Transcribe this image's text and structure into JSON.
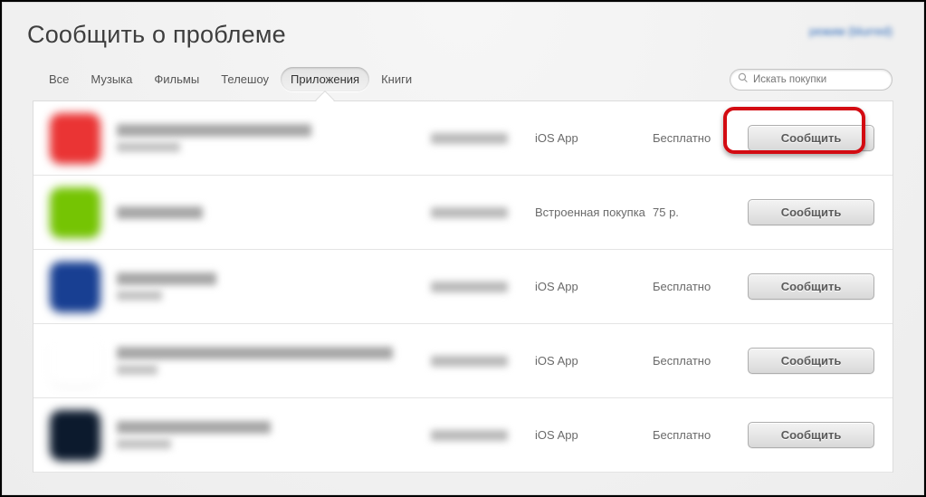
{
  "title": "Сообщить о проблеме",
  "user_id": "режим (blurred)",
  "tabs": [
    {
      "label": "Все",
      "active": false
    },
    {
      "label": "Музыка",
      "active": false
    },
    {
      "label": "Фильмы",
      "active": false
    },
    {
      "label": "Телешоу",
      "active": false
    },
    {
      "label": "Приложения",
      "active": true
    },
    {
      "label": "Книги",
      "active": false
    }
  ],
  "search_placeholder": "Искать покупки",
  "report_button_label": "Сообщить",
  "rows": [
    {
      "icon_color": "#d23a3a",
      "title_w": 215,
      "sub_w": 70,
      "type": "iOS App",
      "price": "Бесплатно",
      "highlight": true
    },
    {
      "icon_color": "#7dbf1e",
      "title_w": 95,
      "sub_w": 0,
      "type": "Встроенная покупка",
      "price": "75 р.",
      "highlight": false
    },
    {
      "icon_color": "#1e3f84",
      "title_w": 110,
      "sub_w": 50,
      "type": "iOS App",
      "price": "Бесплатно",
      "highlight": false
    },
    {
      "icon_color": "#ffffff",
      "title_w": 305,
      "sub_w": 45,
      "type": "iOS App",
      "price": "Бесплатно",
      "highlight": false
    },
    {
      "icon_color": "#0e1a2a",
      "title_w": 170,
      "sub_w": 60,
      "type": "iOS App",
      "price": "Бесплатно",
      "highlight": false
    }
  ]
}
